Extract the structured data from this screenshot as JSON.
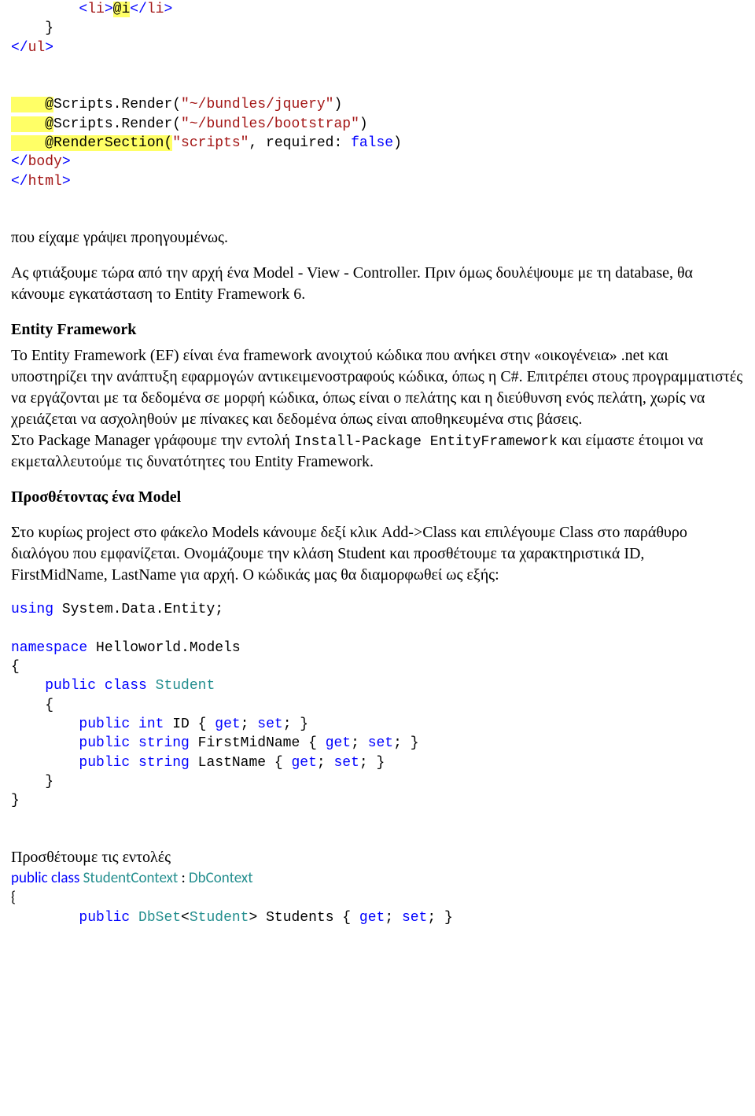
{
  "code1": {
    "l1_a": "        <",
    "l1_b": "li",
    "l1_c": ">",
    "l1_d": "@i",
    "l1_e": "</",
    "l1_f": "li",
    "l1_g": ">",
    "l2": "    }",
    "l3_a": "</",
    "l3_b": "ul",
    "l3_c": ">",
    "l4_a": "    @",
    "l4_b": "Scripts.Render(",
    "l4_c": "\"~/bundles/jquery\"",
    "l4_d": ")",
    "l5_a": "    @",
    "l5_b": "Scripts.Render(",
    "l5_c": "\"~/bundles/bootstrap\"",
    "l5_d": ")",
    "l6_a": "    @RenderSection(",
    "l6_b": "\"scripts\"",
    "l6_c": ", required: ",
    "l6_d": "false",
    "l6_e": ")",
    "l7_a": "</",
    "l7_b": "body",
    "l7_c": ">",
    "l8_a": "</",
    "l8_b": "html",
    "l8_c": ">"
  },
  "para1": "που είχαμε γράψει προηγουμένως.",
  "para2": "Ας φτιάξουμε τώρα από την αρχή ένα Model - View - Controller. Πριν όμως δουλέψουμε με τη database, θα κάνουμε εγκατάσταση το Entity Framework 6.",
  "efHeading": "Entity Framework",
  "para3_part1": "Το Entity Framework (EF) είναι ένα framework ανοιχτού κώδικα που ανήκει στην «οικογένεια» .net και υποστηρίζει την ανάπτυξη εφαρμογών αντικειμενοστραφούς κώδικα, όπως η C#. Επιτρέπει στους προγραμματιστές να εργάζονται με τα δεδομένα σε μορφή κώδικα, όπως είναι ο πελάτης και η διεύθυνση ενός πελάτη, χωρίς να χρειάζεται να ασχοληθούν με πίνακες και δεδομένα όπως είναι αποθηκευμένα στις βάσεις.",
  "para3_part2a": "Στο Package Manager γράφουμε την εντολή ",
  "para3_cmd": "Install-Package EntityFramework",
  "para3_part2b": " και είμαστε έτοιμοι να εκμεταλλευτούμε τις δυνατότητες του Entity Framework.",
  "modelHeading": "Προσθέτοντας ένα Model",
  "para4": "Στο κυρίως project στο φάκελο Models κάνουμε δεξί κλικ Add->Class και επιλέγουμε Class στο παράθυρο διαλόγου που εμφανίζεται. Ονομάζουμε την κλάση Student και προσθέτουμε τα χαρακτηριστικά ID, FirstMidName, LastName για αρχή. Ο κώδικάς μας θα διαμορφωθεί ως εξής:",
  "code2": {
    "l1_a": "using",
    "l1_b": " System.Data.Entity;",
    "l2_a": "namespace",
    "l2_b": " Helloworld.Models",
    "l3": "{",
    "l4_a": "    public",
    "l4_b": " class",
    "l4_c": " Student",
    "l5": "    {",
    "l6_a": "        public",
    "l6_b": " int",
    "l6_c": " ID { ",
    "l6_d": "get",
    "l6_e": "; ",
    "l6_f": "set",
    "l6_g": "; }",
    "l7_a": "        public",
    "l7_b": " string",
    "l7_c": " FirstMidName { ",
    "l7_d": "get",
    "l7_e": "; ",
    "l7_f": "set",
    "l7_g": "; }",
    "l8_a": "        public",
    "l8_b": " string",
    "l8_c": " LastName { ",
    "l8_d": "get",
    "l8_e": "; ",
    "l8_f": "set",
    "l8_g": "; }",
    "l9": "    }",
    "l10": "}"
  },
  "para5": "Προσθέτουμε τις εντολές",
  "code3": {
    "l1_a": "public",
    "l1_b": " class",
    "l1_c": " StudentContext",
    "l1_d": " : ",
    "l1_e": "DbContext",
    "l2": "{",
    "l3_a": "        public",
    "l3_b": " DbSet",
    "l3_c": "<",
    "l3_d": "Student",
    "l3_e": "> Students { ",
    "l3_f": "get",
    "l3_g": "; ",
    "l3_h": "set",
    "l3_i": "; }"
  }
}
